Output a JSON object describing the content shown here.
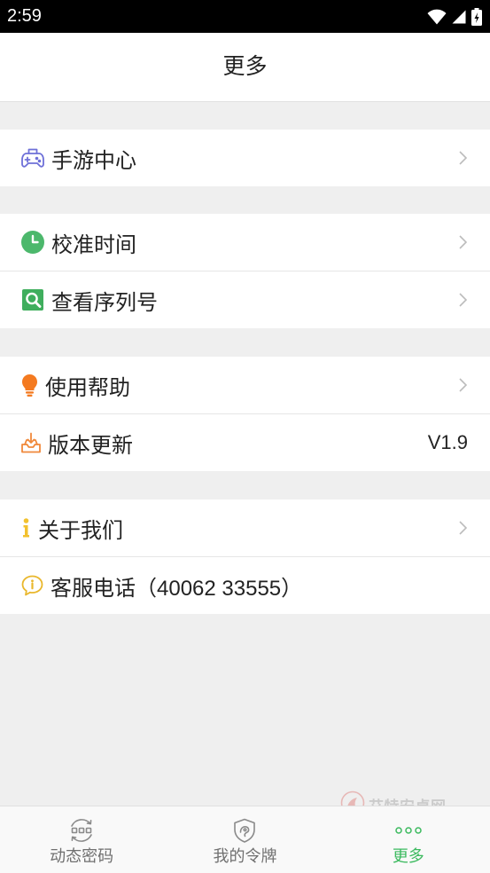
{
  "status_bar": {
    "time": "2:59",
    "icons": [
      "wifi-icon",
      "signal-icon",
      "battery-charging-icon"
    ]
  },
  "header": {
    "title": "更多"
  },
  "groups": [
    {
      "items": [
        {
          "label": "手游中心",
          "icon": "gamepad-icon",
          "has_chevron": true
        }
      ]
    },
    {
      "items": [
        {
          "label": "校准时间",
          "icon": "clock-icon",
          "has_chevron": true
        },
        {
          "label": "查看序列号",
          "icon": "search-icon",
          "has_chevron": true
        }
      ]
    },
    {
      "items": [
        {
          "label": "使用帮助",
          "icon": "lightbulb-icon",
          "has_chevron": true
        },
        {
          "label": "版本更新",
          "icon": "update-icon",
          "value": "V1.9"
        }
      ]
    },
    {
      "items": [
        {
          "label": "关于我们",
          "icon": "info-icon",
          "has_chevron": true
        },
        {
          "label": "客服电话（40062 33555）",
          "icon": "chat-info-icon"
        }
      ]
    }
  ],
  "tabs": [
    {
      "label": "动态密码",
      "icon": "dynamic-password-icon",
      "active": false
    },
    {
      "label": "我的令牌",
      "icon": "shield-icon",
      "active": false
    },
    {
      "label": "更多",
      "icon": "more-dots-icon",
      "active": true
    }
  ],
  "watermark": {
    "text": "艾特安卓网"
  },
  "colors": {
    "background": "#efefef",
    "accent": "#3cba5f",
    "text": "#222222",
    "tab_inactive": "#707070",
    "gamepad": "#6e70d8",
    "clock": "#4cb86c",
    "search": "#3fae5d",
    "lightbulb": "#f47a20",
    "update": "#f0893b",
    "info": "#f2c12e",
    "chat": "#e9b72c"
  }
}
